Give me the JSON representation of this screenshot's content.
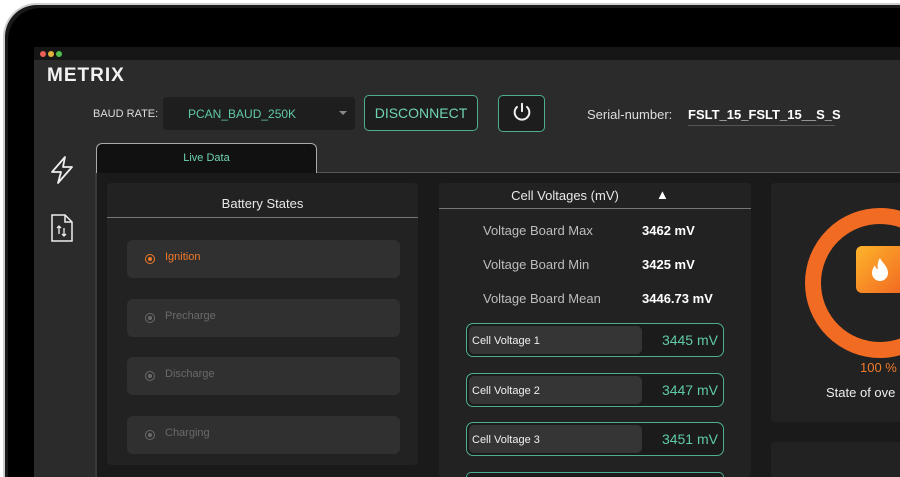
{
  "app": {
    "logo": "METRIX"
  },
  "toolbar": {
    "baud_label": "BAUD RATE:",
    "baud_value": "PCAN_BAUD_250K",
    "disconnect_label": "DISCONNECT",
    "serial_label": "Serial-number:",
    "serial_value": "FSLT_15_FSLT_15__S_S"
  },
  "tabs": [
    {
      "label": "Live Data"
    }
  ],
  "battery_states": {
    "title": "Battery States",
    "items": [
      {
        "label": "Ignition",
        "active": true
      },
      {
        "label": "Precharge",
        "active": false
      },
      {
        "label": "Discharge",
        "active": false
      },
      {
        "label": "Charging",
        "active": false
      }
    ]
  },
  "cell_voltages": {
    "title": "Cell Voltages (mV)",
    "sort_icon": "▲",
    "stats": [
      {
        "label": "Voltage Board Max",
        "value": "3462 mV"
      },
      {
        "label": "Voltage Board Min",
        "value": "3425 mV"
      },
      {
        "label": "Voltage Board Mean",
        "value": "3446.73 mV"
      }
    ],
    "cells": [
      {
        "label": "Cell Voltage 1",
        "value": "3445  mV"
      },
      {
        "label": "Cell Voltage 2",
        "value": "3447  mV"
      },
      {
        "label": "Cell Voltage 3",
        "value": "3451  mV"
      }
    ]
  },
  "state_panel": {
    "percent": "100 %",
    "percent_value": 100,
    "label": "State of ove"
  },
  "colors": {
    "accent": "#5fcaa6",
    "orange": "#f26b22"
  }
}
